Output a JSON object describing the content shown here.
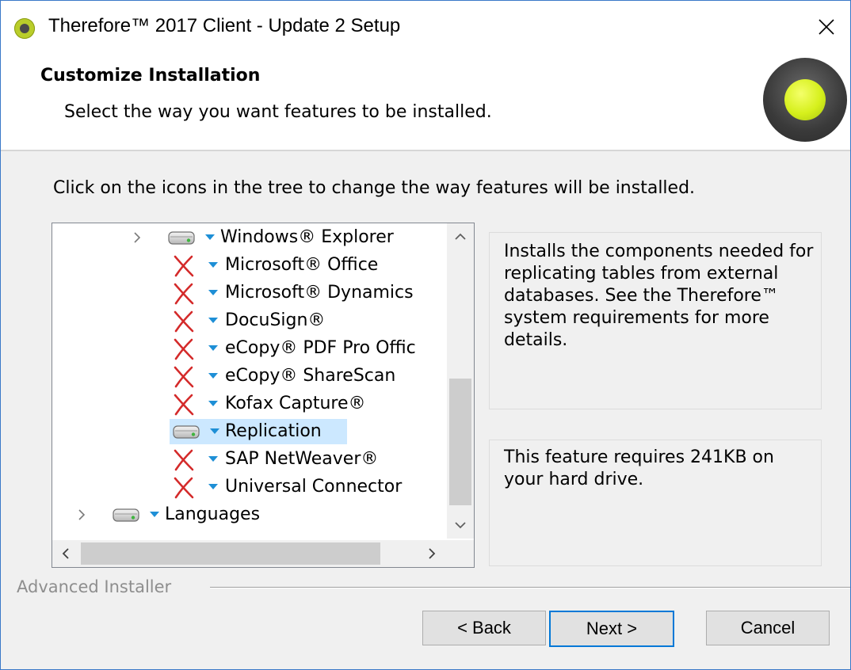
{
  "window": {
    "title": "Therefore™ 2017 Client - Update 2 Setup",
    "close_glyph": "✕"
  },
  "header": {
    "title": "Customize Installation",
    "subtitle": "Select the way you want features to be installed.",
    "logo_icon": "therefore-logo-icon"
  },
  "instruction": "Click on the icons in the tree to change the way features will be installed.",
  "tree": {
    "items": [
      {
        "label": "Windows® Explorer",
        "icon": "hard-drive-icon",
        "state": "installed",
        "expander": "›",
        "selected": false
      },
      {
        "label": "Microsoft® Office",
        "icon": "red-x-icon",
        "state": "not-installed",
        "expander": "",
        "selected": false
      },
      {
        "label": "Microsoft® Dynamics",
        "icon": "red-x-icon",
        "state": "not-installed",
        "expander": "",
        "selected": false
      },
      {
        "label": "DocuSign®",
        "icon": "red-x-icon",
        "state": "not-installed",
        "expander": "",
        "selected": false
      },
      {
        "label": "eCopy® PDF Pro Offic",
        "icon": "red-x-icon",
        "state": "not-installed",
        "expander": "",
        "selected": false
      },
      {
        "label": "eCopy® ShareScan",
        "icon": "red-x-icon",
        "state": "not-installed",
        "expander": "",
        "selected": false
      },
      {
        "label": "Kofax Capture®",
        "icon": "red-x-icon",
        "state": "not-installed",
        "expander": "",
        "selected": false
      },
      {
        "label": "Replication",
        "icon": "hard-drive-icon",
        "state": "installed",
        "expander": "",
        "selected": true
      },
      {
        "label": "SAP NetWeaver®",
        "icon": "red-x-icon",
        "state": "not-installed",
        "expander": "",
        "selected": false
      },
      {
        "label": "Universal Connector",
        "icon": "red-x-icon",
        "state": "not-installed",
        "expander": "",
        "selected": false
      },
      {
        "label": "Languages",
        "icon": "hard-drive-icon",
        "state": "installed",
        "expander": "›",
        "selected": false
      }
    ],
    "scroll": {
      "up": "^",
      "down": "v",
      "left": "<",
      "right": ">"
    }
  },
  "description": "Installs the components needed for replicating tables from external databases. See the Therefore™ system requirements for more details.",
  "requirement": "This feature requires 241KB on your hard drive.",
  "branding": "Advanced Installer",
  "buttons": {
    "back": "< Back",
    "next": "Next >",
    "cancel": "Cancel"
  },
  "colors": {
    "accent": "#0078d7",
    "selection": "#cce8ff",
    "not_installed_x": "#d42a2a",
    "dropdown_arrow": "#1e8fd6"
  }
}
